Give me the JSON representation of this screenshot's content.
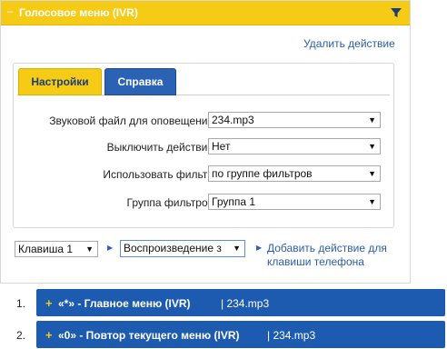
{
  "panel": {
    "collapse_glyph": "–",
    "title": "Голосовое меню (IVR)",
    "filter_icon": "filter-icon",
    "delete_link": "Удалить действие"
  },
  "tabs": {
    "settings": "Настройки",
    "help": "Справка"
  },
  "form": {
    "sound_file": {
      "label": "Звуковой файл для оповещения",
      "value": "234.mp3"
    },
    "disable_action": {
      "label": "Выключить действие",
      "value": "Нет"
    },
    "use_filter": {
      "label": "Использовать фильтр",
      "value": "по группе фильтров"
    },
    "filter_group": {
      "label": "Группа фильтров",
      "value": "Группа 1"
    }
  },
  "action_row": {
    "key_select": "Клавиша 1",
    "playback_select": "Воспроизведение з",
    "add_link": "Добавить действие для клавиши телефона"
  },
  "menu_items": [
    {
      "number": "1.",
      "name": "«*» - Главное меню (IVR)",
      "file": "| 234.mp3"
    },
    {
      "number": "2.",
      "name": "«0» - Повтор текущего меню (IVR)",
      "file": "| 234.mp3"
    }
  ],
  "colors": {
    "header_yellow": "#f6cb16",
    "tab_blue": "#2c62b4",
    "menu_bar_blue": "#1d5bb0",
    "link_blue": "#2a5caa"
  }
}
